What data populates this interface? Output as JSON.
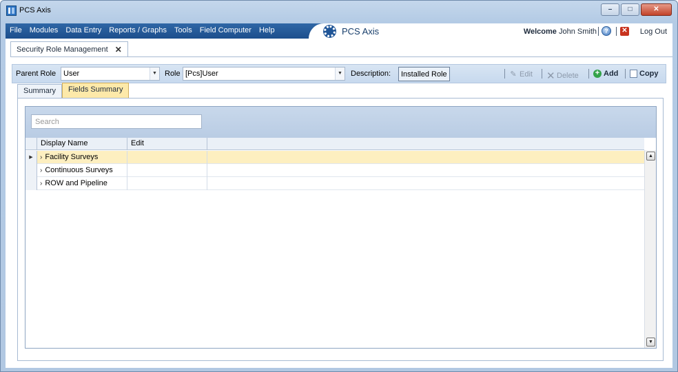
{
  "window": {
    "title": "PCS Axis"
  },
  "menu": {
    "items": [
      "File",
      "Modules",
      "Data Entry",
      "Reports / Graphs",
      "Tools",
      "Field Computer",
      "Help"
    ]
  },
  "brand": {
    "name": "PCS Axis"
  },
  "user": {
    "welcome_label": "Welcome",
    "name": "John Smith",
    "logout_label": "Log Out"
  },
  "document_tab": {
    "label": "Security Role Management"
  },
  "role_bar": {
    "parent_role_label": "Parent Role",
    "parent_role_value": "User",
    "role_label": "Role",
    "role_value": "[Pcs]User",
    "description_label": "Description:",
    "description_value": "Installed Role",
    "edit_label": "Edit",
    "delete_label": "Delete",
    "add_label": "Add",
    "copy_label": "Copy"
  },
  "tabs": [
    {
      "label": "Summary"
    },
    {
      "label": "Fields Summary"
    }
  ],
  "grid": {
    "search_placeholder": "Search",
    "columns": [
      "Display Name",
      "Edit"
    ],
    "rows": [
      {
        "name": "Facility Surveys"
      },
      {
        "name": "Continuous Surveys"
      },
      {
        "name": "ROW and Pipeline"
      }
    ]
  },
  "colors": {
    "menu_blue": "#1c4e8c",
    "selected_row": "#fdefc0",
    "active_tab": "#fde9a9"
  }
}
